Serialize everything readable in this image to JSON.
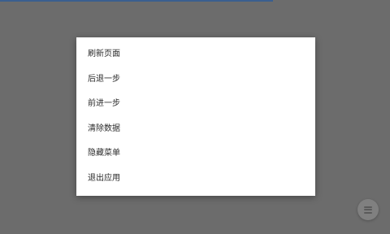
{
  "menu": {
    "items": [
      {
        "label": "刷新页面"
      },
      {
        "label": "后退一步"
      },
      {
        "label": "前进一步"
      },
      {
        "label": "清除数据"
      },
      {
        "label": "隐藏菜单"
      },
      {
        "label": "退出应用"
      }
    ]
  },
  "fab": {
    "icon": "menu-icon"
  },
  "colors": {
    "overlay": "#6c6c6c",
    "progress": "#3a5f8f",
    "menu_bg": "#ffffff",
    "fab": "#808080"
  }
}
